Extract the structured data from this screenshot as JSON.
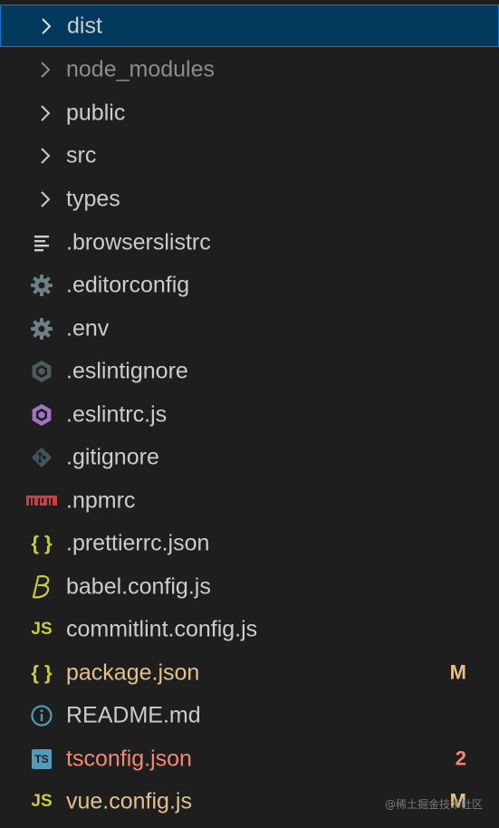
{
  "explorer": {
    "items": [
      {
        "label": "dist",
        "kind": "folder",
        "icon": "chevron-right-icon",
        "state": "selected"
      },
      {
        "label": "node_modules",
        "kind": "folder",
        "icon": "chevron-right-icon",
        "state": "dim"
      },
      {
        "label": "public",
        "kind": "folder",
        "icon": "chevron-right-icon"
      },
      {
        "label": "src",
        "kind": "folder",
        "icon": "chevron-right-icon"
      },
      {
        "label": "types",
        "kind": "folder",
        "icon": "chevron-right-icon"
      },
      {
        "label": ".browserslistrc",
        "kind": "file",
        "icon": "lines-file-icon"
      },
      {
        "label": ".editorconfig",
        "kind": "file",
        "icon": "gear-icon"
      },
      {
        "label": ".env",
        "kind": "file",
        "icon": "gear-icon"
      },
      {
        "label": ".eslintignore",
        "kind": "file",
        "icon": "eslint-gray-icon"
      },
      {
        "label": ".eslintrc.js",
        "kind": "file",
        "icon": "eslint-purple-icon"
      },
      {
        "label": ".gitignore",
        "kind": "file",
        "icon": "git-icon"
      },
      {
        "label": ".npmrc",
        "kind": "file",
        "icon": "npm-icon"
      },
      {
        "label": ".prettierrc.json",
        "kind": "file",
        "icon": "json-braces-icon"
      },
      {
        "label": "babel.config.js",
        "kind": "file",
        "icon": "babel-icon"
      },
      {
        "label": "commitlint.config.js",
        "kind": "file",
        "icon": "js-icon"
      },
      {
        "label": "package.json",
        "kind": "file",
        "icon": "json-braces-icon",
        "state": "modified",
        "badge": "M"
      },
      {
        "label": "README.md",
        "kind": "file",
        "icon": "info-icon"
      },
      {
        "label": "tsconfig.json",
        "kind": "file",
        "icon": "ts-icon",
        "state": "error",
        "badge": "2"
      },
      {
        "label": "vue.config.js",
        "kind": "file",
        "icon": "js-icon",
        "state": "modified",
        "badge": "M"
      }
    ],
    "icon_text": {
      "js": "JS",
      "ts": "TS",
      "braces": "{ }"
    }
  },
  "watermark": "@稀土掘金技术社区",
  "colors": {
    "background": "#1e1e1e",
    "selected_bg": "#04395e",
    "selected_border": "#0b7ad1",
    "text": "#cccccc",
    "dim_text": "#8c8c8c",
    "modified": "#e2c08d",
    "error": "#f48771",
    "js_yellow": "#cbcb41",
    "ts_blue": "#519aba",
    "eslint_purple": "#a074c4",
    "npm_red": "#cc3e44",
    "icon_gray": "#6d8086"
  }
}
